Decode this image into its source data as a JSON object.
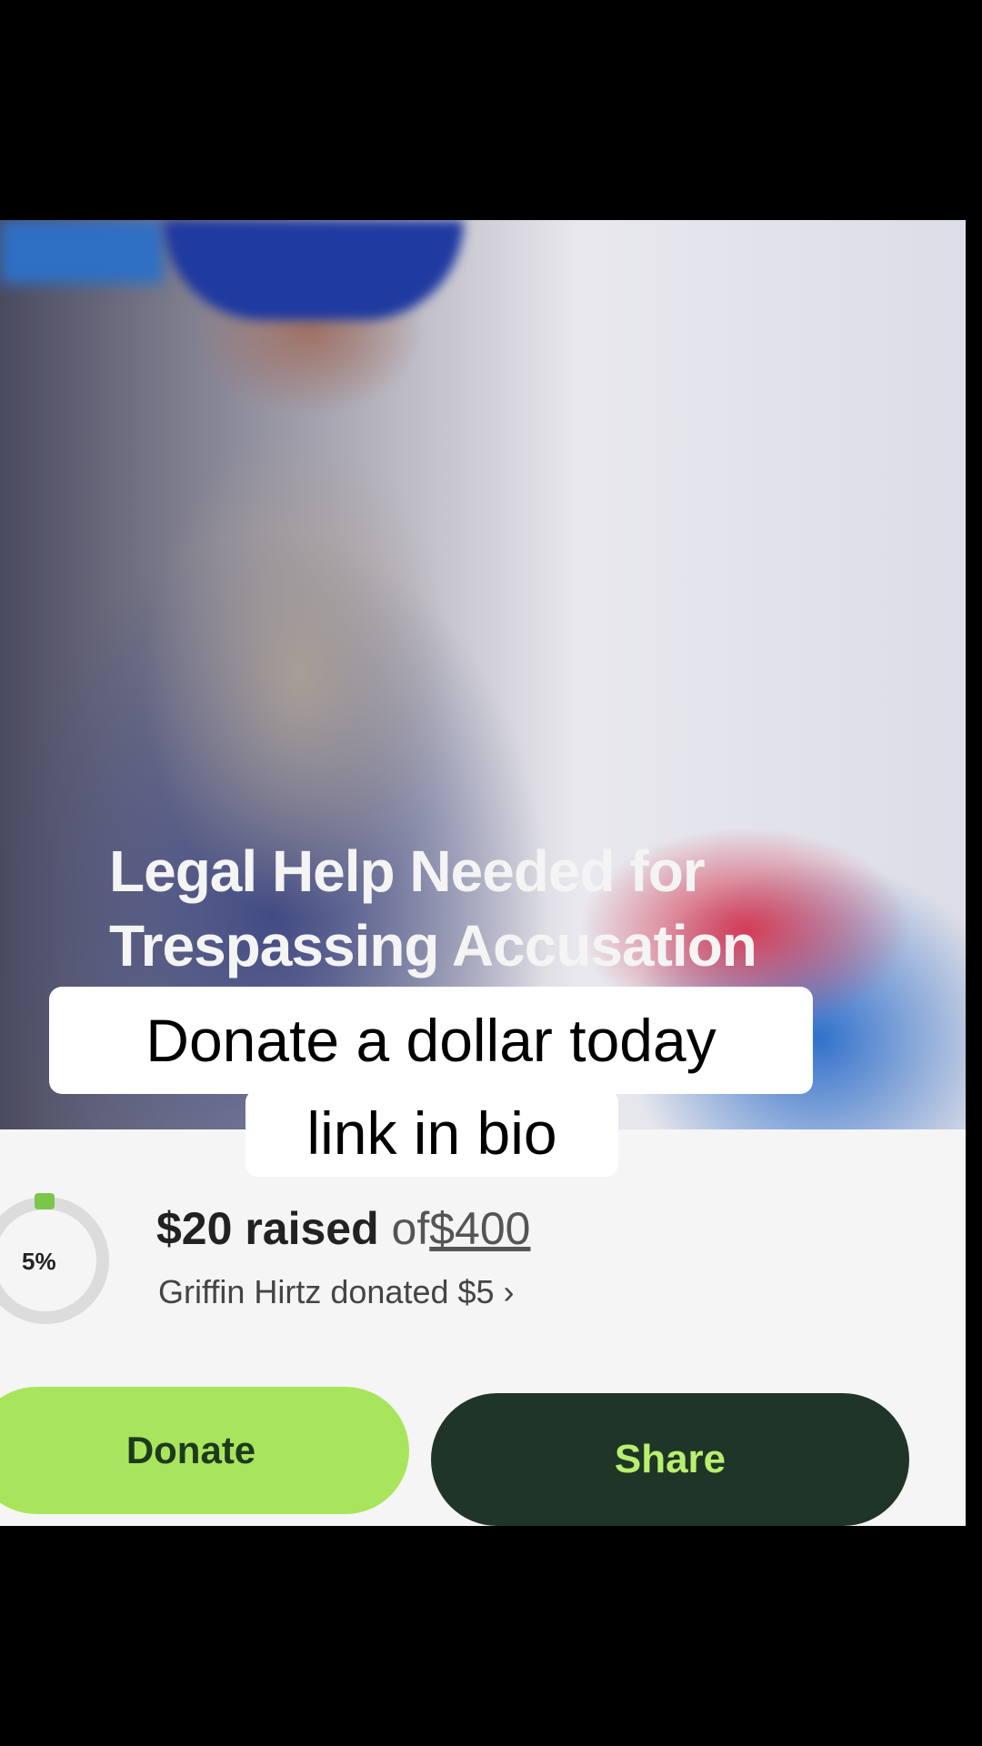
{
  "fundraiser": {
    "title_line1": "Legal Help Needed for",
    "title_line2": "Trespassing Accusation",
    "raised_amount": "$20 raised",
    "of_text": "of",
    "goal_amount": "$400",
    "progress_label": "5%",
    "progress_fraction": 0.05,
    "recent_donation": "Griffin Hirtz donated $5",
    "chevron": "›"
  },
  "buttons": {
    "donate_label": "Donate",
    "share_label": "Share"
  },
  "caption": {
    "line1": "Donate a dollar today",
    "line2": "link in bio"
  },
  "colors": {
    "donate_bg": "#a9e55c",
    "share_bg": "#1f3527",
    "share_text": "#b9ef6e",
    "progress_accent": "#7bc54b"
  }
}
